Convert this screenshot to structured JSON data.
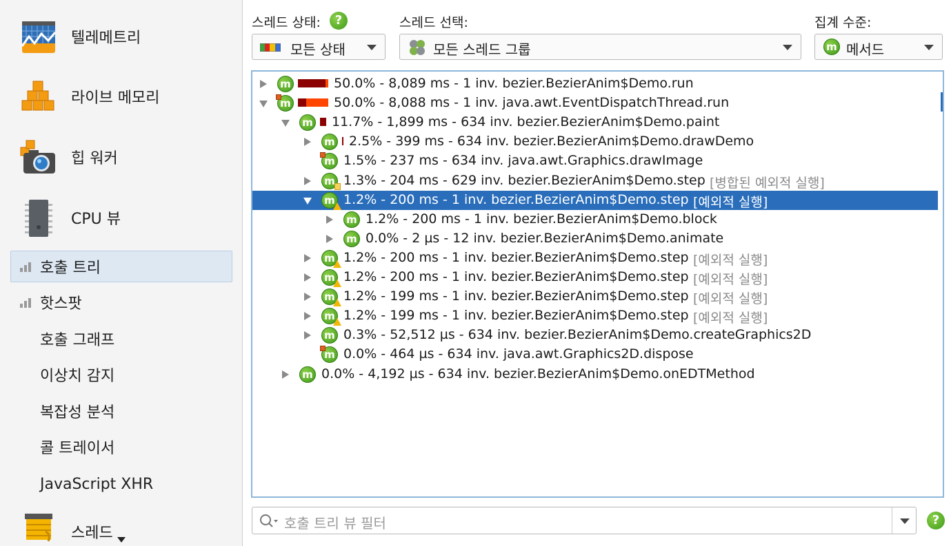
{
  "sidebar": {
    "big_items": [
      {
        "label": "텔레메트리",
        "icon": "telemetry-icon"
      },
      {
        "label": "라이브 메모리",
        "icon": "live-memory-icon"
      },
      {
        "label": "힙 워커",
        "icon": "heap-walker-icon"
      },
      {
        "label": "CPU 뷰",
        "icon": "cpu-views-icon"
      }
    ],
    "sub_items": [
      {
        "label": "호출 트리",
        "selected": true,
        "bars": true
      },
      {
        "label": "핫스팟",
        "selected": false,
        "bars": true
      },
      {
        "label": "호출 그래프",
        "selected": false,
        "bars": false
      },
      {
        "label": "이상치 감지",
        "selected": false,
        "bars": false
      },
      {
        "label": "복잡성 분석",
        "selected": false,
        "bars": false
      },
      {
        "label": "콜 트레이서",
        "selected": false,
        "bars": false
      },
      {
        "label": "JavaScript XHR",
        "selected": false,
        "bars": false
      }
    ],
    "partial_item": {
      "label": "스레드",
      "icon": "threads-icon"
    }
  },
  "controls": {
    "thread_status": {
      "label": "스레드 상태:",
      "value": "모든 상태"
    },
    "thread_select": {
      "label": "스레드 선택:",
      "value": "모든 스레드 그룹"
    },
    "aggregation": {
      "label": "집계 수준:",
      "value": "메서드"
    }
  },
  "tree": {
    "rows": [
      {
        "depth": 0,
        "toggle": "collapsed",
        "badge": "none",
        "bar": [
          {
            "w": 40,
            "c": "#8b0000"
          },
          {
            "w": 4,
            "c": "#ff4500"
          }
        ],
        "text": "50.0% - 8,089 ms - 1 inv. bezier.BezierAnim$Demo.run",
        "note": ""
      },
      {
        "depth": 0,
        "toggle": "expanded",
        "badge": "corner",
        "bar": [
          {
            "w": 12,
            "c": "#8b0000"
          },
          {
            "w": 32,
            "c": "#ff4500"
          }
        ],
        "text": "50.0% - 8,088 ms - 1 inv. java.awt.EventDispatchThread.run",
        "note": ""
      },
      {
        "depth": 1,
        "toggle": "expanded",
        "badge": "none",
        "bar": [
          {
            "w": 9,
            "c": "#8b0000"
          }
        ],
        "text": "11.7% - 1,899 ms - 634 inv. bezier.BezierAnim$Demo.paint",
        "note": ""
      },
      {
        "depth": 2,
        "toggle": "collapsed",
        "badge": "none",
        "bar": [
          {
            "w": 2,
            "c": "#8b0000"
          }
        ],
        "text": "2.5% - 399 ms - 634 inv. bezier.BezierAnim$Demo.drawDemo",
        "note": ""
      },
      {
        "depth": 2,
        "toggle": "none",
        "badge": "corner",
        "bar": [],
        "text": "1.5% - 237 ms - 634 inv. java.awt.Graphics.drawImage",
        "note": ""
      },
      {
        "depth": 2,
        "toggle": "collapsed",
        "badge": "flag",
        "bar": [],
        "text": "1.3% - 204 ms - 629 inv. bezier.BezierAnim$Demo.step",
        "note": "[병합된 예외적 실행]"
      },
      {
        "depth": 2,
        "toggle": "expanded",
        "badge": "warn",
        "bar": [],
        "text": "1.2% - 200 ms - 1 inv. bezier.BezierAnim$Demo.step",
        "note": "[예외적 실행]",
        "selected": true
      },
      {
        "depth": 3,
        "toggle": "collapsed",
        "badge": "none",
        "bar": [],
        "text": "1.2% - 200 ms - 1 inv. bezier.BezierAnim$Demo.block",
        "note": ""
      },
      {
        "depth": 3,
        "toggle": "collapsed",
        "badge": "none",
        "bar": [],
        "text": "0.0% - 2 µs - 12 inv. bezier.BezierAnim$Demo.animate",
        "note": ""
      },
      {
        "depth": 2,
        "toggle": "collapsed",
        "badge": "warn",
        "bar": [],
        "text": "1.2% - 200 ms - 1 inv. bezier.BezierAnim$Demo.step",
        "note": "[예외적 실행]"
      },
      {
        "depth": 2,
        "toggle": "collapsed",
        "badge": "warn",
        "bar": [],
        "text": "1.2% - 200 ms - 1 inv. bezier.BezierAnim$Demo.step",
        "note": "[예외적 실행]"
      },
      {
        "depth": 2,
        "toggle": "collapsed",
        "badge": "warn",
        "bar": [],
        "text": "1.2% - 199 ms - 1 inv. bezier.BezierAnim$Demo.step",
        "note": "[예외적 실행]"
      },
      {
        "depth": 2,
        "toggle": "collapsed",
        "badge": "warn",
        "bar": [],
        "text": "1.2% - 199 ms - 1 inv. bezier.BezierAnim$Demo.step",
        "note": "[예외적 실행]"
      },
      {
        "depth": 2,
        "toggle": "collapsed",
        "badge": "none",
        "bar": [],
        "text": "0.3% - 52,512 µs - 634 inv. bezier.BezierAnim$Demo.createGraphics2D",
        "note": ""
      },
      {
        "depth": 2,
        "toggle": "none",
        "badge": "corner",
        "bar": [],
        "text": "0.0% - 464 µs - 634 inv. java.awt.Graphics2D.dispose",
        "note": ""
      },
      {
        "depth": 1,
        "toggle": "collapsed",
        "badge": "none",
        "bar": [],
        "text": "0.0% - 4,192 µs - 634 inv. bezier.BezierAnim$Demo.onEDTMethod",
        "note": ""
      }
    ]
  },
  "filter": {
    "placeholder": "호출 트리 뷰 필터"
  },
  "icons": {
    "method": "m",
    "help": "?"
  }
}
